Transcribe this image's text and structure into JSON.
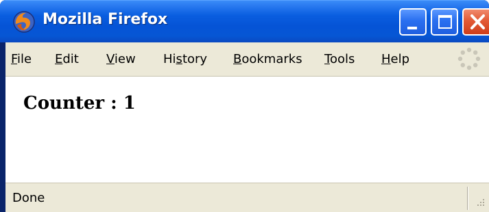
{
  "window": {
    "title": "Mozilla Firefox",
    "icon": "firefox-logo-icon"
  },
  "controls": {
    "minimize_icon": "minimize-icon",
    "maximize_icon": "maximize-icon",
    "close_icon": "close-icon"
  },
  "menu": {
    "items": [
      {
        "pre": "",
        "key": "F",
        "post": "ile"
      },
      {
        "pre": "",
        "key": "E",
        "post": "dit"
      },
      {
        "pre": "",
        "key": "V",
        "post": "iew"
      },
      {
        "pre": "Hi",
        "key": "s",
        "post": "tory"
      },
      {
        "pre": "",
        "key": "B",
        "post": "ookmarks"
      },
      {
        "pre": "",
        "key": "T",
        "post": "ools"
      },
      {
        "pre": "",
        "key": "H",
        "post": "elp"
      }
    ],
    "throbber_icon": "throbber-icon"
  },
  "content": {
    "heading": "Counter : 1"
  },
  "status": {
    "text": "Done"
  },
  "colors": {
    "titlebar": "#0554d6",
    "close_button": "#e25a36",
    "chrome": "#ece9d8",
    "frame": "#0a246a"
  }
}
